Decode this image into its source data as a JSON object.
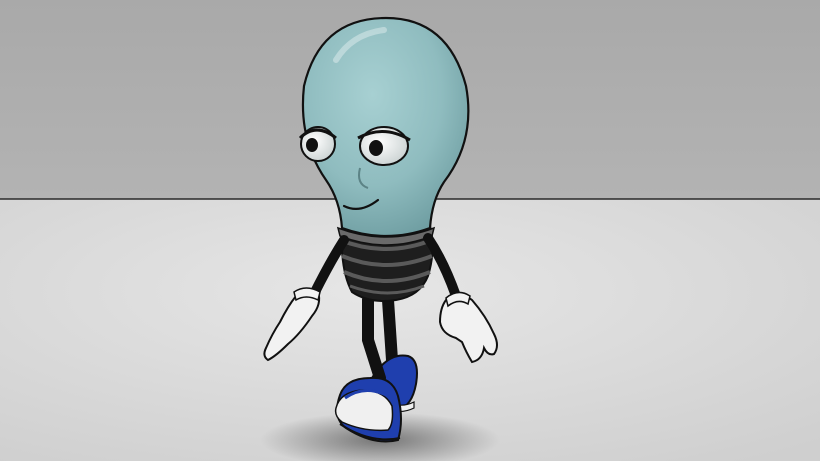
{
  "scene": {
    "subject": "lightbulb-character",
    "colors": {
      "wall": "#aeaeae",
      "floor": "#d9d9d9",
      "bulb_glass": "#8fbcbf",
      "outline": "#111111",
      "body_black": "#1a1a1a",
      "glove": "#f2f2f2",
      "shoe_blue": "#1f3fae",
      "shoe_white": "#f0f0f0"
    }
  }
}
